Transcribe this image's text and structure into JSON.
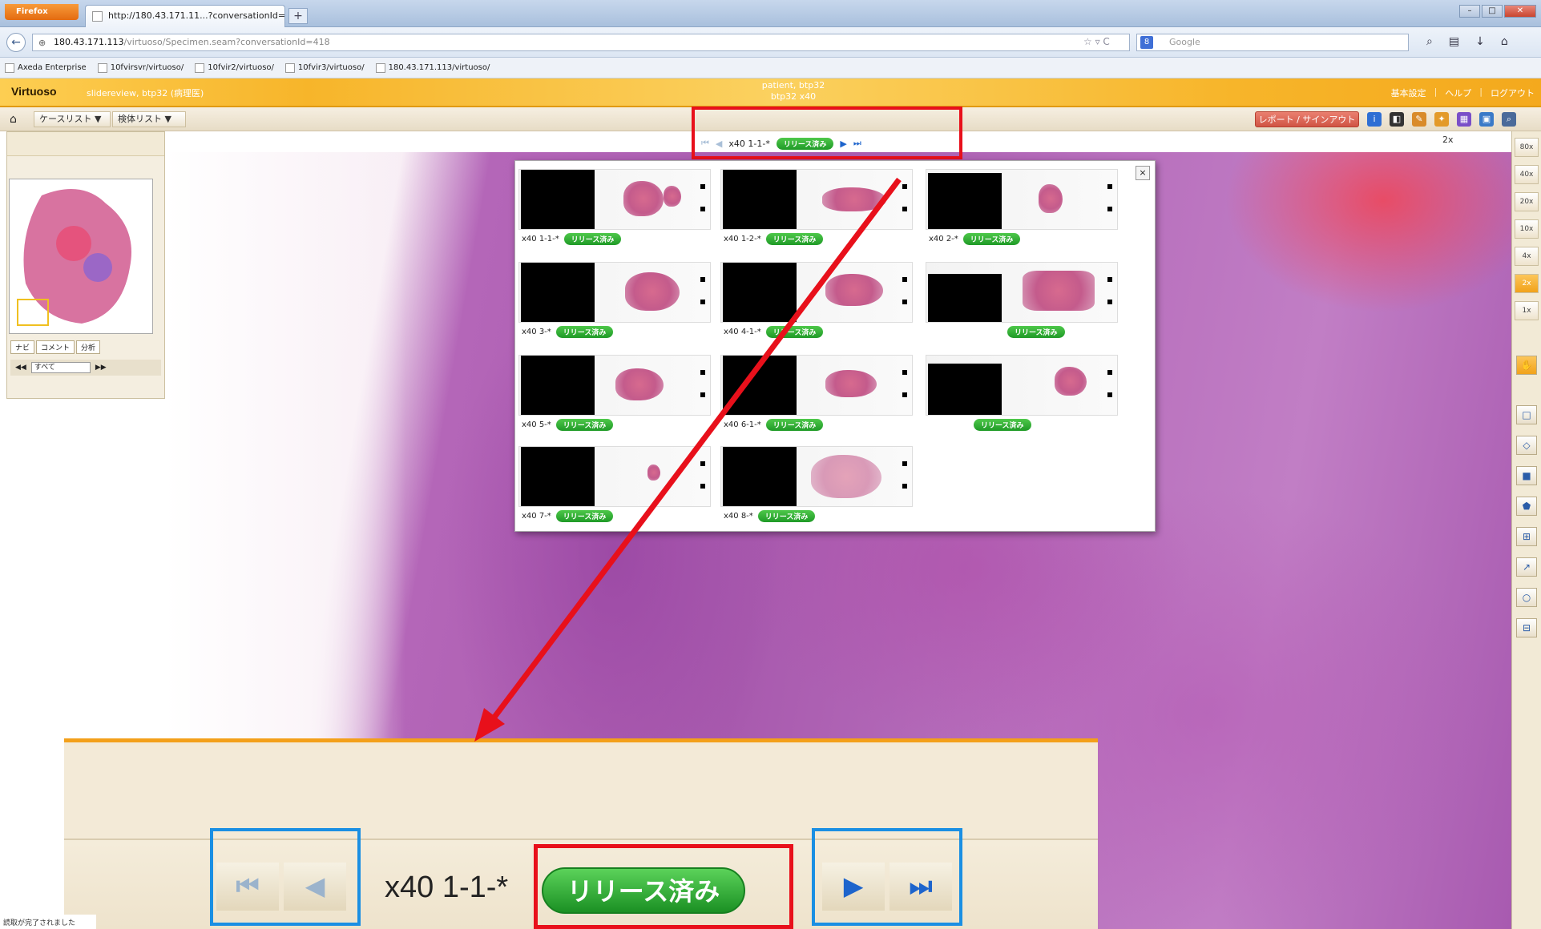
{
  "browser": {
    "app_button": "Firefox",
    "tab_title": "http://180.43.171.11...?conversationId=418",
    "url_host": "180.43.171.113",
    "url_path": "/virtuoso/Specimen.seam?conversationId=418",
    "search_engine_placeholder": "Google",
    "bookmarks": [
      "Axeda Enterprise",
      "10fvirsvr/virtuoso/",
      "10fvir2/virtuoso/",
      "10fvir3/virtuoso/",
      "180.43.171.113/virtuoso/"
    ]
  },
  "app": {
    "logo": "Virtuoso",
    "subtitle": "slidereview, btp32 (病理医)",
    "patient_line1": "patient, btp32",
    "patient_line2": "btp32 x40",
    "header_links": [
      "基本設定",
      "ヘルプ",
      "ログアウト"
    ]
  },
  "toolbar": {
    "case_list": "ケースリスト ▼",
    "specimen_list": "検体リスト ▼",
    "report_button": "レポート / サインアウト",
    "zoom_indicator": "2x"
  },
  "slide_nav": {
    "current_label": "x40 1-1-*",
    "status_pill": "リリース済み"
  },
  "left_panel": {
    "tabs": [
      "ナビ",
      "コメント",
      "分析"
    ],
    "filter_value": "すべて"
  },
  "zoom_levels": [
    "80x",
    "40x",
    "20x",
    "10x",
    "4x",
    "2x",
    "1x"
  ],
  "active_zoom": "2x",
  "popup": {
    "slides": [
      {
        "label": "x40 1-1-*",
        "status": "リリース済み"
      },
      {
        "label": "x40 1-2-*",
        "status": "リリース済み"
      },
      {
        "label": "x40 2-*",
        "status": "リリース済み"
      },
      {
        "label": "x40 3-*",
        "status": "リリース済み"
      },
      {
        "label": "x40 4-1-*",
        "status": "リリース済み"
      },
      {
        "label": "",
        "status": "リリース済み"
      },
      {
        "label": "x40 5-*",
        "status": "リリース済み"
      },
      {
        "label": "x40 6-1-*",
        "status": "リリース済み"
      },
      {
        "label": "",
        "status": "リリース済み"
      },
      {
        "label": "x40 7-*",
        "status": "リリース済み"
      },
      {
        "label": "x40 8-*",
        "status": "リリース済み"
      }
    ]
  },
  "callout": {
    "label": "x40 1-1-*",
    "status_pill": "リリース済み"
  },
  "status_bar": "読取が完了されました"
}
